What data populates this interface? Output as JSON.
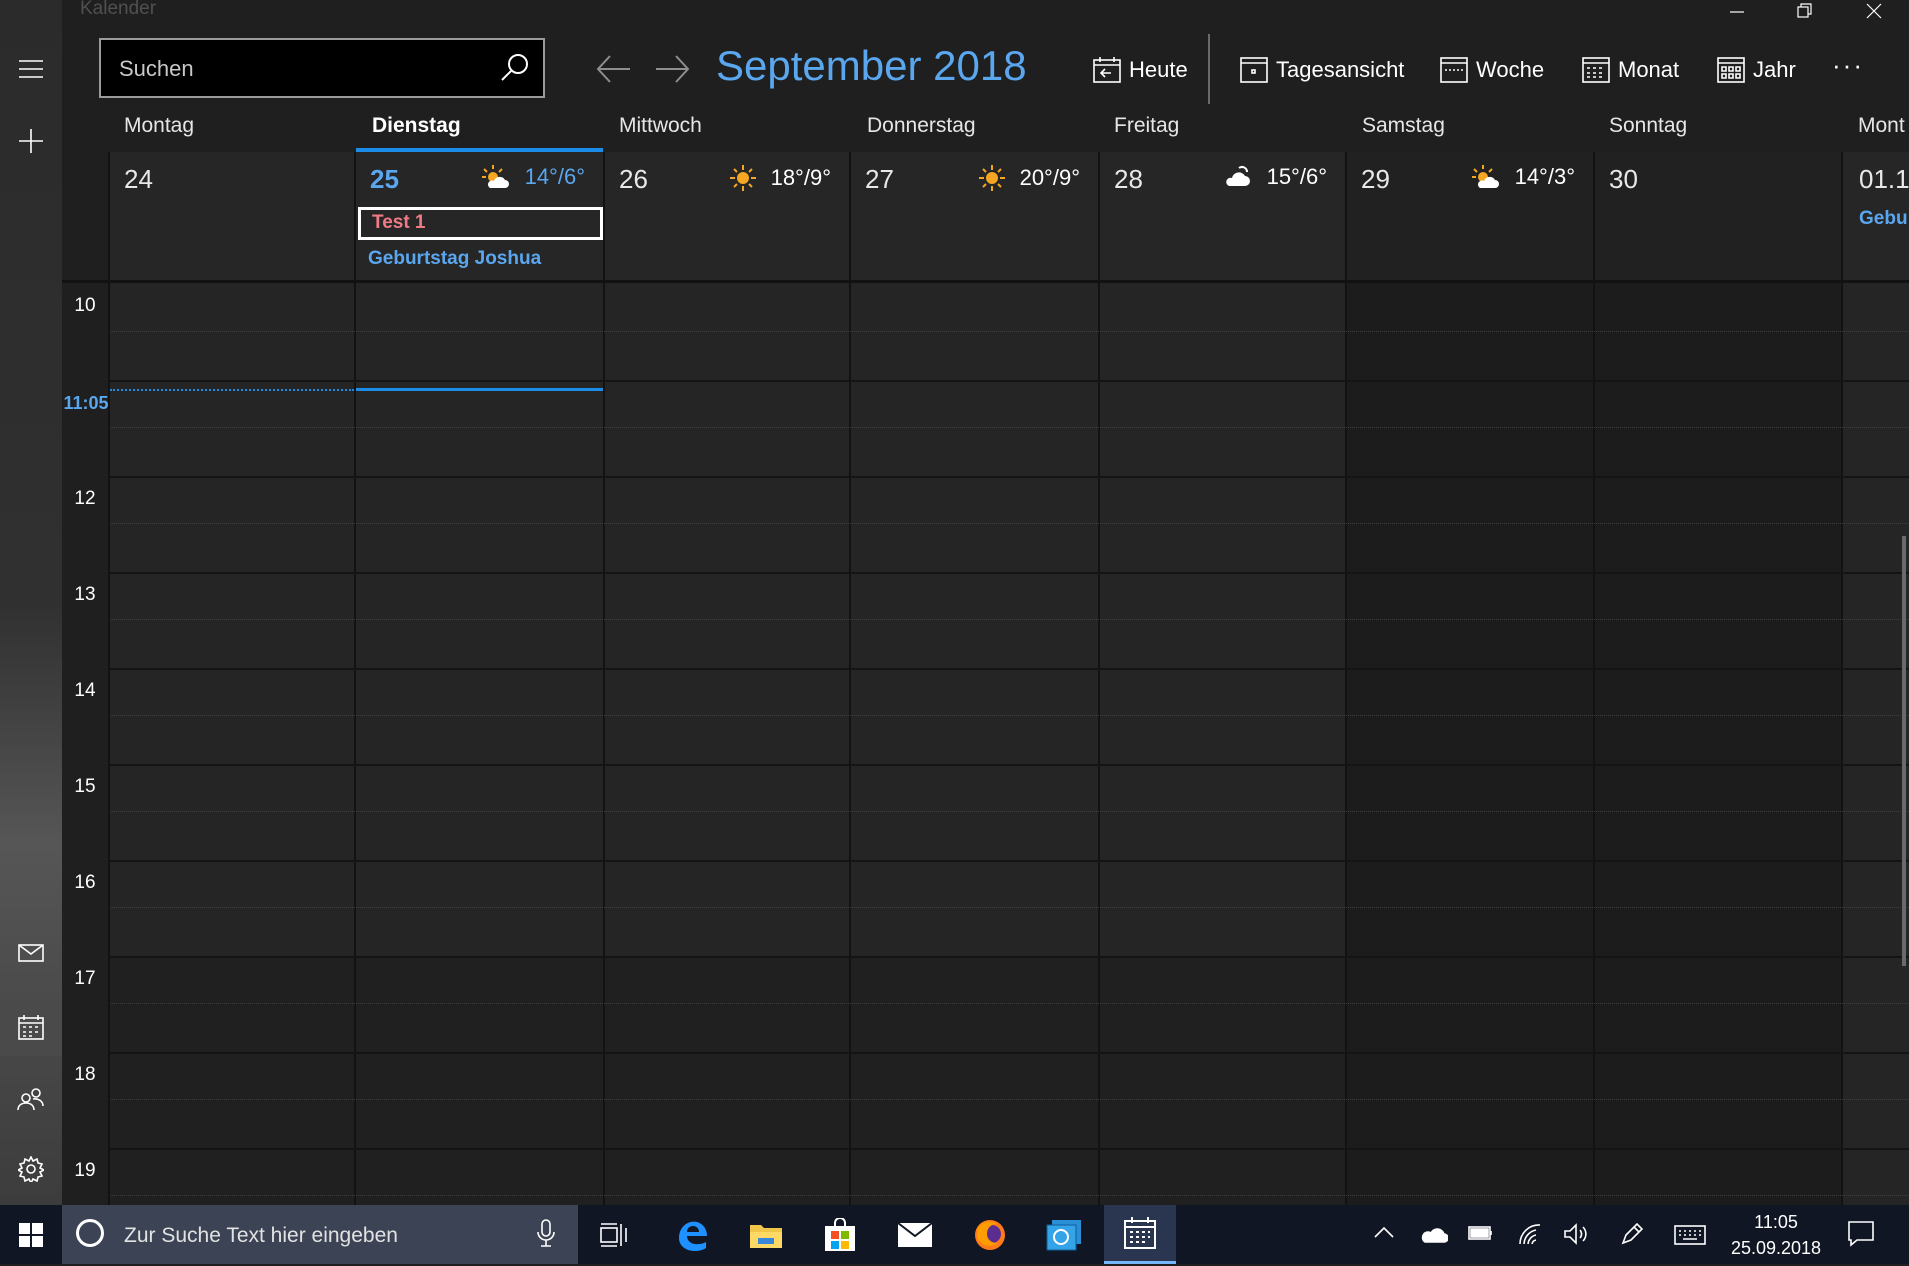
{
  "app": {
    "title": "Kalender"
  },
  "toolbar": {
    "search_placeholder": "Suchen",
    "month_title": "September 2018",
    "today_label": "Heute",
    "day_view_label": "Tagesansicht",
    "week_view_label": "Woche",
    "month_view_label": "Monat",
    "year_view_label": "Jahr",
    "more_label": "···"
  },
  "week": {
    "days": [
      {
        "name": "Montag",
        "number": "24",
        "weather_icon": "",
        "temp": "",
        "today": false,
        "weekend": false
      },
      {
        "name": "Dienstag",
        "number": "25",
        "weather_icon": "partly-cloudy-icon",
        "temp": "14°/6°",
        "today": true,
        "weekend": false
      },
      {
        "name": "Mittwoch",
        "number": "26",
        "weather_icon": "sun-icon",
        "temp": "18°/9°",
        "today": false,
        "weekend": false
      },
      {
        "name": "Donnerstag",
        "number": "27",
        "weather_icon": "sun-icon",
        "temp": "20°/9°",
        "today": false,
        "weekend": false
      },
      {
        "name": "Freitag",
        "number": "28",
        "weather_icon": "cloud-sun-icon",
        "temp": "15°/6°",
        "today": false,
        "weekend": false
      },
      {
        "name": "Samstag",
        "number": "29",
        "weather_icon": "partly-cloudy-icon",
        "temp": "14°/3°",
        "today": false,
        "weekend": true
      },
      {
        "name": "Sonntag",
        "number": "30",
        "weather_icon": "",
        "temp": "",
        "today": false,
        "weekend": true
      },
      {
        "name": "Mont",
        "number": "01.1",
        "weather_icon": "",
        "temp": "",
        "today": false,
        "weekend": false
      }
    ],
    "events": {
      "tuesday_selected": "Test 1",
      "tuesday_birthday": "Geburtstag Joshua",
      "next_monday_partial": "Gebu"
    },
    "hours": [
      "10",
      "12",
      "13",
      "14",
      "15",
      "16",
      "17",
      "18",
      "19"
    ],
    "now_label": "11:05"
  },
  "taskbar": {
    "search_placeholder": "Zur Suche Text hier eingeben",
    "time": "11:05",
    "date": "25.09.2018"
  },
  "colors": {
    "accent": "#5aa7f0",
    "today_line": "#1b8ce8",
    "selected_event": "#f07a85",
    "background": "#1f1f1f",
    "taskbar": "#101623"
  }
}
